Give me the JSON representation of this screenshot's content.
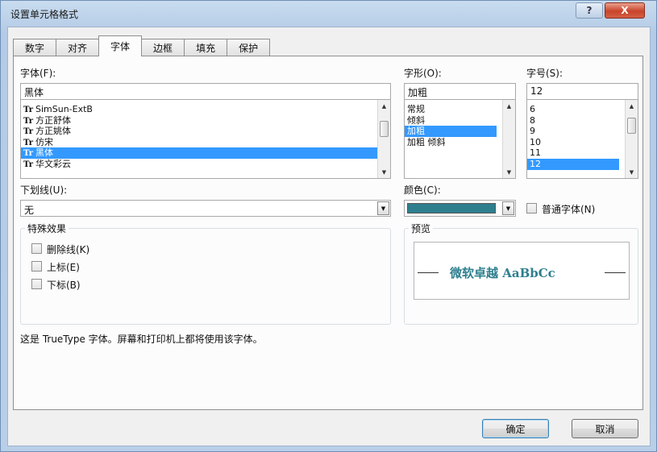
{
  "window": {
    "title": "设置单元格格式",
    "help_label": "?",
    "close_label": "X"
  },
  "tabs": [
    {
      "label": "数字"
    },
    {
      "label": "对齐"
    },
    {
      "label": "字体"
    },
    {
      "label": "边框"
    },
    {
      "label": "填充"
    },
    {
      "label": "保护"
    }
  ],
  "active_tab": "字体",
  "font": {
    "label": "字体(F):",
    "value": "黑体",
    "items": [
      {
        "icon": "Tr",
        "name": "SimSun-ExtB"
      },
      {
        "icon": "Tr",
        "name": "方正舒体"
      },
      {
        "icon": "Tr",
        "name": "方正姚体"
      },
      {
        "icon": "Tr",
        "name": "仿宋"
      },
      {
        "icon": "Tr",
        "name": "黑体",
        "selected": true
      },
      {
        "icon": "Tr",
        "name": "华文彩云"
      }
    ]
  },
  "style": {
    "label": "字形(O):",
    "value": "加粗",
    "items": [
      {
        "name": "常规"
      },
      {
        "name": "倾斜"
      },
      {
        "name": "加粗",
        "selected": true
      },
      {
        "name": "加粗 倾斜"
      }
    ]
  },
  "size": {
    "label": "字号(S):",
    "value": "12",
    "items": [
      {
        "name": "6"
      },
      {
        "name": "8"
      },
      {
        "name": "9"
      },
      {
        "name": "10"
      },
      {
        "name": "11"
      },
      {
        "name": "12",
        "selected": true
      }
    ]
  },
  "underline": {
    "label": "下划线(U):",
    "value": "无"
  },
  "color": {
    "label": "颜色(C):",
    "swatch": "#2e7f8e"
  },
  "normal_font": {
    "label": "普通字体(N)",
    "checked": false
  },
  "effects": {
    "title": "特殊效果",
    "items": [
      {
        "label": "删除线(K)",
        "checked": false
      },
      {
        "label": "上标(E)",
        "checked": false
      },
      {
        "label": "下标(B)",
        "checked": false
      }
    ]
  },
  "preview": {
    "title": "预览",
    "text": "微软卓越  AaBbCc",
    "color": "#2e7f8e"
  },
  "info_text": "这是 TrueType 字体。屏幕和打印机上都将使用该字体。",
  "buttons": {
    "ok": "确定",
    "cancel": "取消"
  }
}
